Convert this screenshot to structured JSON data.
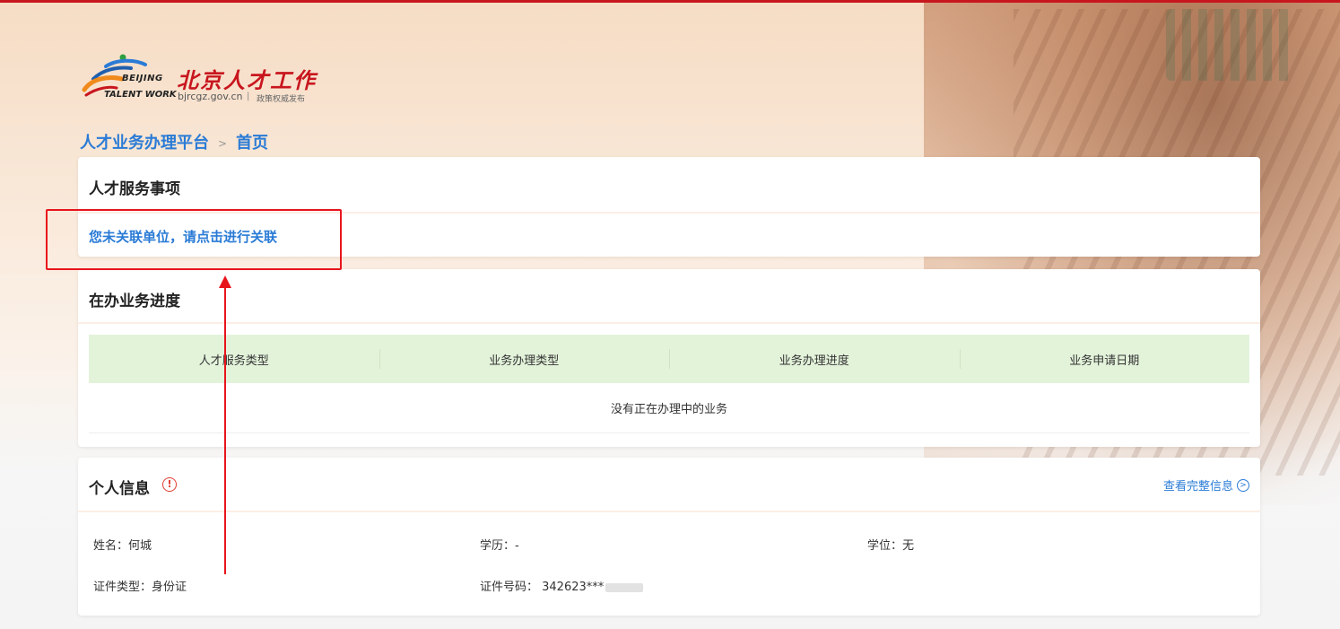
{
  "logo": {
    "en_line1": "BEIJING",
    "en_line2": "TALENT WORK",
    "cn_name": "北京人才工作",
    "url": "bjrcgz.gov.cn",
    "separator": "|",
    "slogan": "政策权威发布"
  },
  "breadcrumb": {
    "platform": "人才业务办理平台",
    "separator": ">",
    "current": "首页"
  },
  "services_card": {
    "title": "人才服务事项",
    "associate_link": "您未关联单位，请点击进行关联"
  },
  "progress_card": {
    "title": "在办业务进度",
    "columns": [
      "人才服务类型",
      "业务办理类型",
      "业务办理进度",
      "业务申请日期"
    ],
    "empty_text": "没有正在办理中的业务"
  },
  "personal_card": {
    "title": "个人信息",
    "warning_symbol": "!",
    "view_full_label": "查看完整信息",
    "view_full_arrow": ">",
    "fields": {
      "name": "姓名：何城",
      "education": "学历：-",
      "degree": "学位：无",
      "id_type": "证件类型：身份证",
      "id_number": "证件号码：  342623***"
    }
  },
  "colors": {
    "brand_red": "#c8161e",
    "link_blue": "#2a7bd6",
    "table_header_green": "#e3f3da",
    "annotation_red": "#e8141c"
  }
}
